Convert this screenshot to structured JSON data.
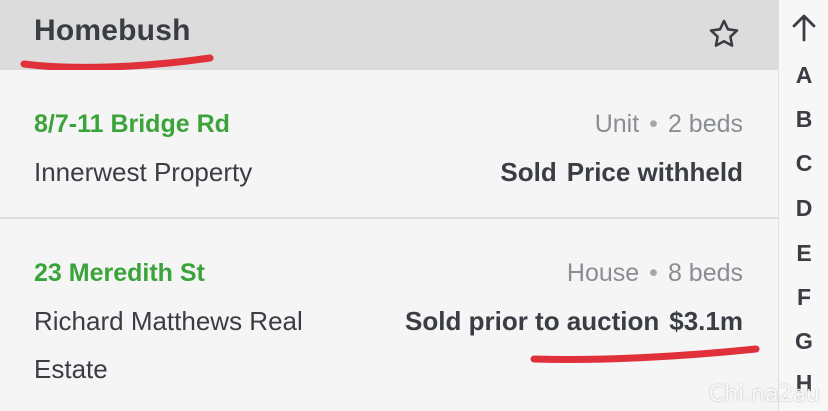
{
  "header": {
    "title": "Homebush",
    "favorite_icon": "star-outline-icon"
  },
  "listings": [
    {
      "address": "8/7-11 Bridge Rd",
      "type": "Unit",
      "separator": "•",
      "beds": "2 beds",
      "agency": "Innerwest Property",
      "status": "Sold",
      "price": "Price withheld"
    },
    {
      "address": "23 Meredith St",
      "type": "House",
      "separator": "•",
      "beds": "8 beds",
      "agency": "Richard Matthews Real Estate",
      "status": "Sold prior to auction",
      "price": "$3.1m"
    }
  ],
  "alpha_index": {
    "top_icon": "arrow-up-icon",
    "letters": [
      "A",
      "B",
      "C",
      "D",
      "E",
      "F",
      "G",
      "H"
    ]
  },
  "colors": {
    "address_green": "#3aa33a",
    "annotation_red": "#e0303a",
    "header_bg": "#dcdcdc"
  },
  "watermark": "Chi.na2au"
}
